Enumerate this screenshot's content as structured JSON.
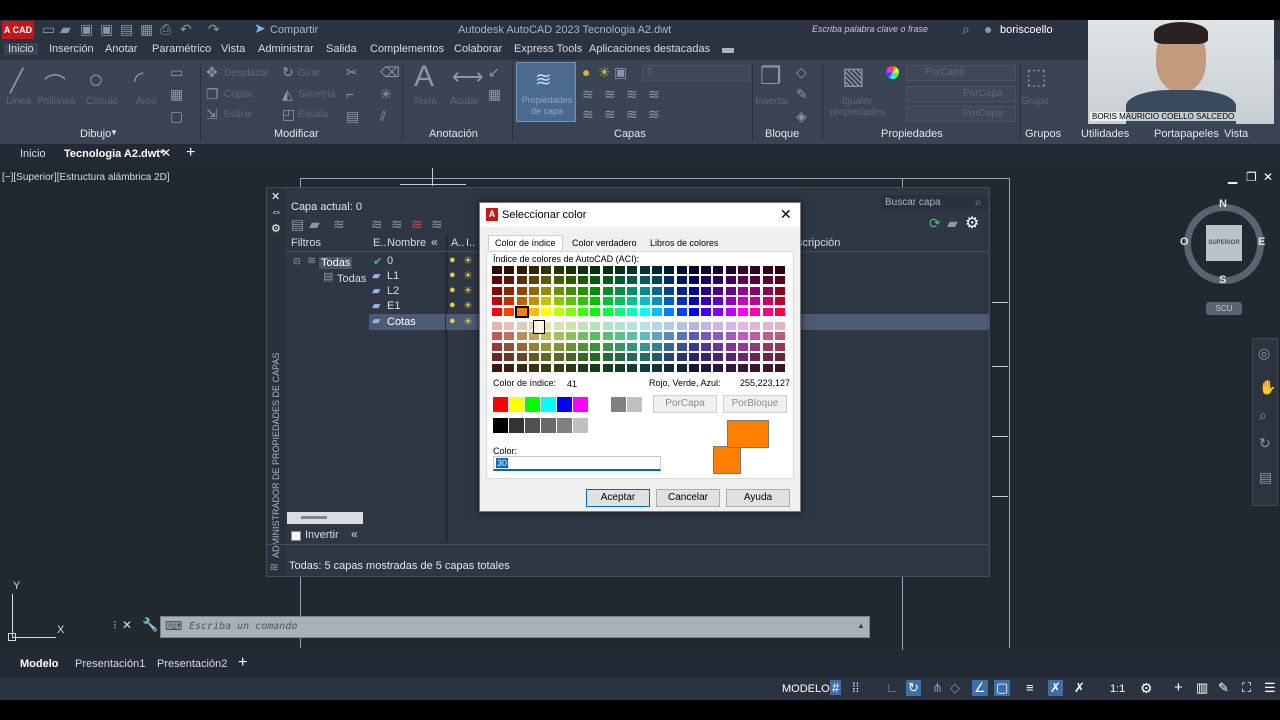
{
  "titlebar": {
    "app_badge": "A CAD",
    "share": "Compartir",
    "title": "Autodesk AutoCAD 2023   Tecnologia A2.dwt",
    "search_placeholder": "Escriba palabra clave o frase",
    "user": "boriscoello"
  },
  "ribbon_tabs": [
    "Inicio",
    "Inserción",
    "Anotar",
    "Paramétrico",
    "Vista",
    "Administrar",
    "Salida",
    "Complementos",
    "Colaborar",
    "Express Tools",
    "Aplicaciones destacadas"
  ],
  "ribbon": {
    "draw_tools": [
      "Línea",
      "Polilínea",
      "Círculo",
      "Arco"
    ],
    "modify_tools": [
      "Desplazar",
      "Girar",
      "Copiar",
      "Simetría",
      "Estirar",
      "Escala"
    ],
    "text_tools": [
      "Texto",
      "Acotar"
    ],
    "layer_props": "Propiedades de capa",
    "layer_value": "0",
    "block_tool": "Insertar",
    "match_props": "Igualar propiedades",
    "props_values": [
      "PorCapa",
      "PorCapa",
      "PorCapa"
    ],
    "group_tool": "Grupo",
    "panels": [
      "Dibujo",
      "Modificar",
      "Anotación",
      "Capas",
      "Bloque",
      "Propiedades",
      "Grupos",
      "Utilidades",
      "Portapapeles",
      "Vista"
    ]
  },
  "doc_tabs": {
    "home": "Inicio",
    "active": "Tecnologia A2.dwt*"
  },
  "viewport": {
    "label": "[−][Superior][Estructura alámbrica 2D]",
    "viewcube_top": "SUPERIOR",
    "compass": {
      "n": "N",
      "s": "S",
      "e": "E",
      "o": "O"
    },
    "ucs": "SCU",
    "axis_y": "Y",
    "axis_x": "X"
  },
  "webcam": {
    "caption": "BORIS MAURICIO COELLO SALCEDO"
  },
  "layer_panel": {
    "current_layer": "Capa actual: 0",
    "search_placeholder": "Buscar capa",
    "filters_label": "Filtros",
    "tree": [
      "Todas",
      "Todas"
    ],
    "columns": [
      "E..",
      "Nombre",
      "A..",
      "I..",
      "scripción"
    ],
    "layers": [
      "0",
      "L1",
      "L2",
      "E1",
      "Cotas"
    ],
    "invert_label": "Invertir",
    "side_label": "ADMINISTRADOR DE PROPIEDADES DE CAPAS",
    "status": "Todas: 5 capas mostradas de 5 capas totales"
  },
  "dialog": {
    "title": "Seleccionar color",
    "tabs": [
      "Color de índice",
      "Color verdadero",
      "Libros de colores"
    ],
    "aci_heading": "Índice de colores de AutoCAD (ACI):",
    "index_label": "Color de índice:",
    "index_value": "41",
    "rgb_label": "Rojo, Verde, Azul:",
    "rgb_value": "255,223,127",
    "bylayer": "PorCapa",
    "byblock": "PorBloque",
    "color_label": "Color:",
    "color_value": "30",
    "accept": "Aceptar",
    "cancel": "Cancelar",
    "help": "Ayuda",
    "preview_color": "#ff7f00"
  },
  "command": {
    "placeholder": "Escriba un comando"
  },
  "layout_tabs": [
    "Modelo",
    "Presentación1",
    "Presentación2"
  ],
  "statusbar": {
    "model": "MODELO",
    "scale": "1:1"
  }
}
